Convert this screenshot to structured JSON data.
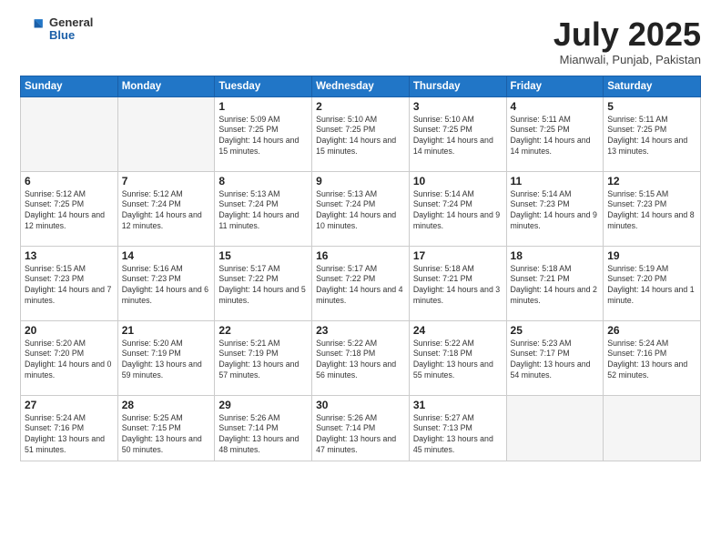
{
  "header": {
    "logo_general": "General",
    "logo_blue": "Blue",
    "month_title": "July 2025",
    "location": "Mianwali, Punjab, Pakistan"
  },
  "days_of_week": [
    "Sunday",
    "Monday",
    "Tuesday",
    "Wednesday",
    "Thursday",
    "Friday",
    "Saturday"
  ],
  "weeks": [
    [
      {
        "day": "",
        "content": ""
      },
      {
        "day": "",
        "content": ""
      },
      {
        "day": "1",
        "content": "Sunrise: 5:09 AM\nSunset: 7:25 PM\nDaylight: 14 hours and 15 minutes."
      },
      {
        "day": "2",
        "content": "Sunrise: 5:10 AM\nSunset: 7:25 PM\nDaylight: 14 hours and 15 minutes."
      },
      {
        "day": "3",
        "content": "Sunrise: 5:10 AM\nSunset: 7:25 PM\nDaylight: 14 hours and 14 minutes."
      },
      {
        "day": "4",
        "content": "Sunrise: 5:11 AM\nSunset: 7:25 PM\nDaylight: 14 hours and 14 minutes."
      },
      {
        "day": "5",
        "content": "Sunrise: 5:11 AM\nSunset: 7:25 PM\nDaylight: 14 hours and 13 minutes."
      }
    ],
    [
      {
        "day": "6",
        "content": "Sunrise: 5:12 AM\nSunset: 7:25 PM\nDaylight: 14 hours and 12 minutes."
      },
      {
        "day": "7",
        "content": "Sunrise: 5:12 AM\nSunset: 7:24 PM\nDaylight: 14 hours and 12 minutes."
      },
      {
        "day": "8",
        "content": "Sunrise: 5:13 AM\nSunset: 7:24 PM\nDaylight: 14 hours and 11 minutes."
      },
      {
        "day": "9",
        "content": "Sunrise: 5:13 AM\nSunset: 7:24 PM\nDaylight: 14 hours and 10 minutes."
      },
      {
        "day": "10",
        "content": "Sunrise: 5:14 AM\nSunset: 7:24 PM\nDaylight: 14 hours and 9 minutes."
      },
      {
        "day": "11",
        "content": "Sunrise: 5:14 AM\nSunset: 7:23 PM\nDaylight: 14 hours and 9 minutes."
      },
      {
        "day": "12",
        "content": "Sunrise: 5:15 AM\nSunset: 7:23 PM\nDaylight: 14 hours and 8 minutes."
      }
    ],
    [
      {
        "day": "13",
        "content": "Sunrise: 5:15 AM\nSunset: 7:23 PM\nDaylight: 14 hours and 7 minutes."
      },
      {
        "day": "14",
        "content": "Sunrise: 5:16 AM\nSunset: 7:23 PM\nDaylight: 14 hours and 6 minutes."
      },
      {
        "day": "15",
        "content": "Sunrise: 5:17 AM\nSunset: 7:22 PM\nDaylight: 14 hours and 5 minutes."
      },
      {
        "day": "16",
        "content": "Sunrise: 5:17 AM\nSunset: 7:22 PM\nDaylight: 14 hours and 4 minutes."
      },
      {
        "day": "17",
        "content": "Sunrise: 5:18 AM\nSunset: 7:21 PM\nDaylight: 14 hours and 3 minutes."
      },
      {
        "day": "18",
        "content": "Sunrise: 5:18 AM\nSunset: 7:21 PM\nDaylight: 14 hours and 2 minutes."
      },
      {
        "day": "19",
        "content": "Sunrise: 5:19 AM\nSunset: 7:20 PM\nDaylight: 14 hours and 1 minute."
      }
    ],
    [
      {
        "day": "20",
        "content": "Sunrise: 5:20 AM\nSunset: 7:20 PM\nDaylight: 14 hours and 0 minutes."
      },
      {
        "day": "21",
        "content": "Sunrise: 5:20 AM\nSunset: 7:19 PM\nDaylight: 13 hours and 59 minutes."
      },
      {
        "day": "22",
        "content": "Sunrise: 5:21 AM\nSunset: 7:19 PM\nDaylight: 13 hours and 57 minutes."
      },
      {
        "day": "23",
        "content": "Sunrise: 5:22 AM\nSunset: 7:18 PM\nDaylight: 13 hours and 56 minutes."
      },
      {
        "day": "24",
        "content": "Sunrise: 5:22 AM\nSunset: 7:18 PM\nDaylight: 13 hours and 55 minutes."
      },
      {
        "day": "25",
        "content": "Sunrise: 5:23 AM\nSunset: 7:17 PM\nDaylight: 13 hours and 54 minutes."
      },
      {
        "day": "26",
        "content": "Sunrise: 5:24 AM\nSunset: 7:16 PM\nDaylight: 13 hours and 52 minutes."
      }
    ],
    [
      {
        "day": "27",
        "content": "Sunrise: 5:24 AM\nSunset: 7:16 PM\nDaylight: 13 hours and 51 minutes."
      },
      {
        "day": "28",
        "content": "Sunrise: 5:25 AM\nSunset: 7:15 PM\nDaylight: 13 hours and 50 minutes."
      },
      {
        "day": "29",
        "content": "Sunrise: 5:26 AM\nSunset: 7:14 PM\nDaylight: 13 hours and 48 minutes."
      },
      {
        "day": "30",
        "content": "Sunrise: 5:26 AM\nSunset: 7:14 PM\nDaylight: 13 hours and 47 minutes."
      },
      {
        "day": "31",
        "content": "Sunrise: 5:27 AM\nSunset: 7:13 PM\nDaylight: 13 hours and 45 minutes."
      },
      {
        "day": "",
        "content": ""
      },
      {
        "day": "",
        "content": ""
      }
    ]
  ]
}
